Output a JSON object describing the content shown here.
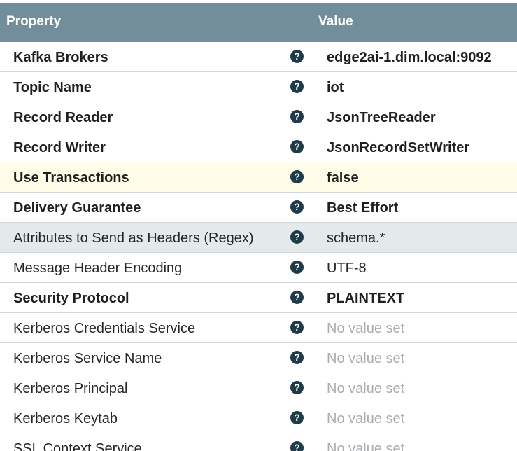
{
  "header": {
    "property": "Property",
    "value": "Value"
  },
  "help_glyph": "?",
  "rows": [
    {
      "name": "Kafka Brokers",
      "value": "edge2ai-1.dim.local:9092",
      "required": true,
      "unset": false
    },
    {
      "name": "Topic Name",
      "value": "iot",
      "required": true,
      "unset": false
    },
    {
      "name": "Record Reader",
      "value": "JsonTreeReader",
      "required": true,
      "unset": false
    },
    {
      "name": "Record Writer",
      "value": "JsonRecordSetWriter",
      "required": true,
      "unset": false
    },
    {
      "name": "Use Transactions",
      "value": "false",
      "required": true,
      "unset": false,
      "state": "selected"
    },
    {
      "name": "Delivery Guarantee",
      "value": "Best Effort",
      "required": true,
      "unset": false
    },
    {
      "name": "Attributes to Send as Headers (Regex)",
      "value": "schema.*",
      "required": false,
      "unset": false,
      "state": "hover"
    },
    {
      "name": "Message Header Encoding",
      "value": "UTF-8",
      "required": false,
      "unset": false
    },
    {
      "name": "Security Protocol",
      "value": "PLAINTEXT",
      "required": true,
      "unset": false
    },
    {
      "name": "Kerberos Credentials Service",
      "value": "No value set",
      "required": false,
      "unset": true
    },
    {
      "name": "Kerberos Service Name",
      "value": "No value set",
      "required": false,
      "unset": true
    },
    {
      "name": "Kerberos Principal",
      "value": "No value set",
      "required": false,
      "unset": true
    },
    {
      "name": "Kerberos Keytab",
      "value": "No value set",
      "required": false,
      "unset": true
    },
    {
      "name": "SSL Context Service",
      "value": "No value set",
      "required": false,
      "unset": true
    }
  ]
}
